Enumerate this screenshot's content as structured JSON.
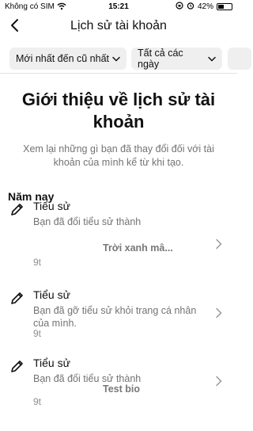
{
  "status_bar": {
    "carrier": "Không có SIM",
    "time": "15:21",
    "battery": "42%",
    "battery_level": 0.42
  },
  "header": {
    "title": "Lịch sử tài khoản"
  },
  "filters": [
    {
      "label": "Mới nhất đến cũ nhất"
    },
    {
      "label": "Tất cả các ngày"
    }
  ],
  "intro": {
    "title": "Giới thiệu về lịch sử tài khoản",
    "description": "Xem lại những gì bạn đã thay đổi đối với tài khoản của mình kể từ khi tạo."
  },
  "section": {
    "title": "Năm nay"
  },
  "items": [
    {
      "title": "Tiểu sử",
      "description": "Bạn đã đổi tiểu sử thành",
      "value": "Trời xanh mâ...",
      "time": "9t"
    },
    {
      "title": "Tiểu sử",
      "description": "Bạn đã gỡ tiểu sử khỏi trang cá nhân của mình.",
      "value": "",
      "time": "9t"
    },
    {
      "title": "Tiểu sử",
      "description": "Bạn đã đổi tiểu sử thành",
      "value": "Test bio",
      "time": "9t"
    }
  ],
  "icons": {
    "back": "chevron-left-icon",
    "wifi": "wifi-icon",
    "alarm": "alarm-icon",
    "lock_rotation": "orientation-lock-icon",
    "filter_chevron": "chevron-down-icon",
    "item_edit": "pencil-icon",
    "item_chevron": "chevron-right-icon"
  }
}
